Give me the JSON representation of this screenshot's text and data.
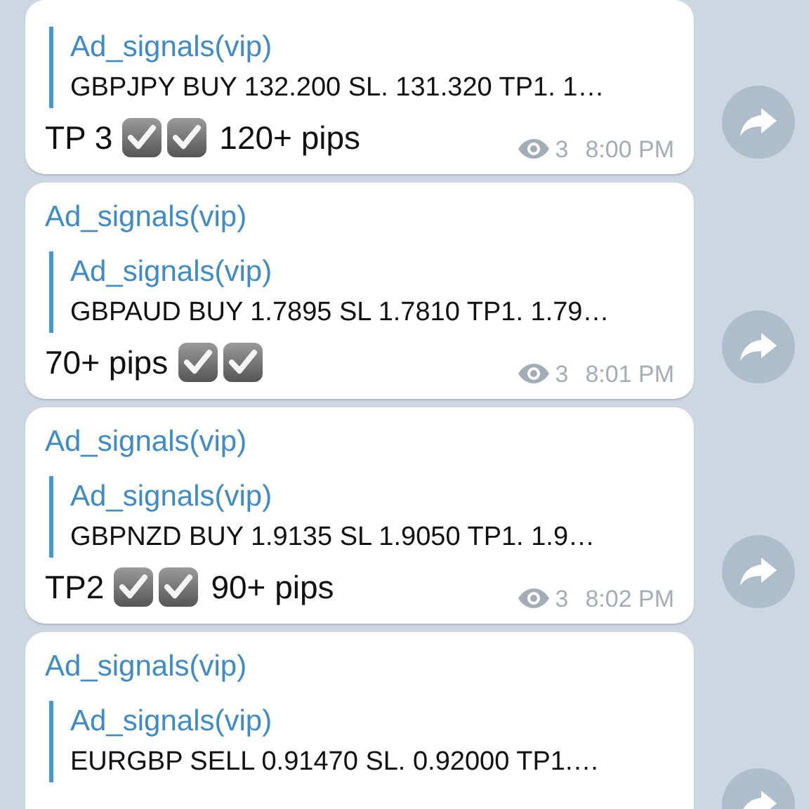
{
  "messages": [
    {
      "quote_sender": "Ad_signals(vip)",
      "quote_text": "GBPJPY BUY 132.200 SL.  131.320 TP1. 1…",
      "result": [
        {
          "kind": "text",
          "text": "TP 3"
        },
        {
          "kind": "check"
        },
        {
          "kind": "check"
        },
        {
          "kind": "text",
          "text": "120+ pips"
        }
      ],
      "views": "3",
      "time": "8:00 PM"
    },
    {
      "sender": "Ad_signals(vip)",
      "quote_sender": "Ad_signals(vip)",
      "quote_text": "GBPAUD BUY 1.7895 SL 1.7810 TP1. 1.79…",
      "result": [
        {
          "kind": "text",
          "text": "70+ pips"
        },
        {
          "kind": "check"
        },
        {
          "kind": "check"
        }
      ],
      "views": "3",
      "time": "8:01 PM"
    },
    {
      "sender": "Ad_signals(vip)",
      "quote_sender": "Ad_signals(vip)",
      "quote_text": "GBPNZD BUY 1.9135 SL 1.9050 TP1.  1.9…",
      "result": [
        {
          "kind": "text",
          "text": "TP2"
        },
        {
          "kind": "check"
        },
        {
          "kind": "check"
        },
        {
          "kind": "text",
          "text": "90+ pips"
        }
      ],
      "views": "3",
      "time": "8:02 PM"
    },
    {
      "sender": "Ad_signals(vip)",
      "quote_sender": "Ad_signals(vip)",
      "quote_text": "EURGBP SELL 0.91470 SL. 0.92000 TP1.…"
    }
  ]
}
